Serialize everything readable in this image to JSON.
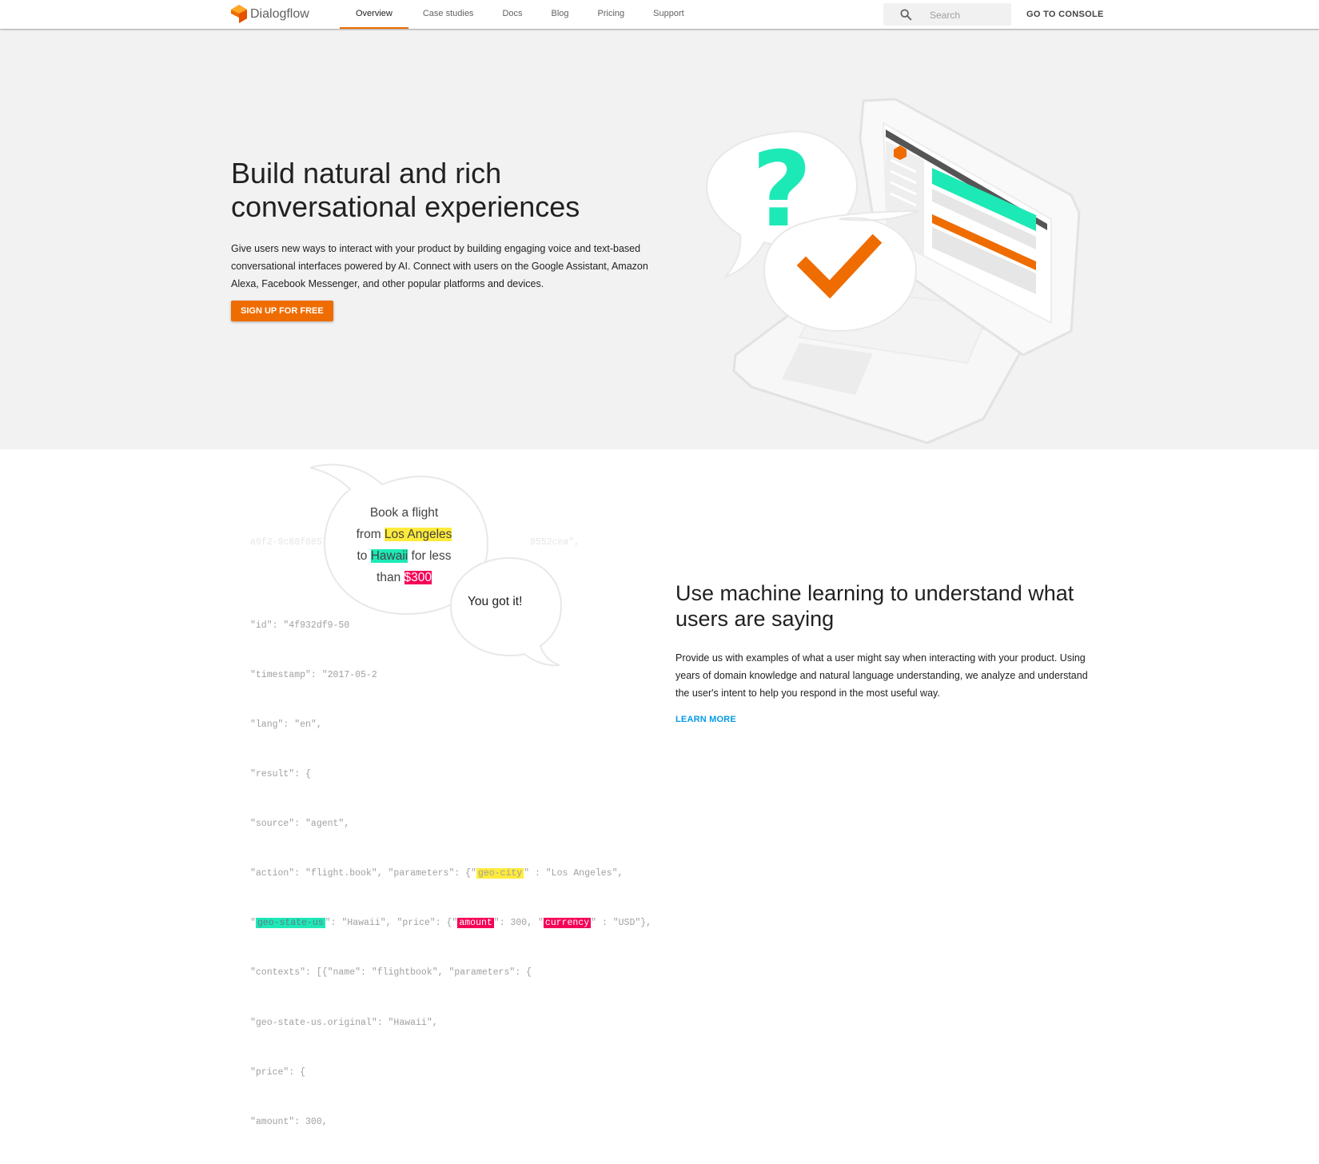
{
  "header": {
    "brand": "Dialogflow",
    "nav": [
      {
        "label": "Overview",
        "active": true
      },
      {
        "label": "Case studies"
      },
      {
        "label": "Docs"
      },
      {
        "label": "Blog"
      },
      {
        "label": "Pricing"
      },
      {
        "label": "Support"
      }
    ],
    "search_placeholder": "Search",
    "console_label": "GO TO CONSOLE"
  },
  "hero": {
    "title": "Build natural and rich conversational experiences",
    "description": "Give users new ways to interact with your product by building engaging voice and text-based conversational interfaces powered by AI. Connect with users on the Google Assistant, Amazon Alexa, Facebook Messenger, and other popular platforms and devices.",
    "cta": "SIGN UP FOR FREE"
  },
  "ml_section": {
    "bubble_user": {
      "line1": "Book a flight",
      "from": "from",
      "city1": "Los Angeles",
      "to": "to",
      "city2": "Hawaii",
      "for_less": "for less",
      "than": "than",
      "price": "$300"
    },
    "bubble_reply": "You got it!",
    "code_lines": [
      "\"id\": \"4f932df9-50",
      "\"timestamp\": \"2017-05-2",
      "\"lang\": \"en\",",
      "\"result\": {",
      "\"source\": \"agent\",",
      "\"action\": \"flight.book\", \"parameters\": {\"",
      "\": \"Hawaii\", \"price\": {\"",
      "\"contexts\": [{\"name\": \"flightbook\", \"parameters\": {",
      "\"geo-state-us.original\": \"Hawaii\",",
      "\"price\": {",
      "\"amount\": 300,"
    ],
    "code_faint": [
      "a9f2-9c88f0857e",
      "9552cea\","
    ],
    "code_tokens": {
      "geo_city": "geo-city",
      "geo_city_value": "\" : \"Los Angeles\",",
      "geo_state_prefix": "\"",
      "geo_state_us": "geo-state-us",
      "amount": "amount",
      "amount_value": "\": 300, \"",
      "currency": "currency",
      "currency_value": "\" : \"USD\"},"
    },
    "title": "Use machine learning to understand what users are saying",
    "description": "Provide us with examples of what a user might say when interacting with your product. Using years of domain knowledge and natural language understanding, we analyze and understand the user's intent to help you respond in the most useful way.",
    "link": "LEARN MORE"
  },
  "colors": {
    "accent": "#ef6c00",
    "teal": "#1de9b6",
    "yellow": "#ffeb3b",
    "pink": "#f50057",
    "link": "#039be5"
  }
}
